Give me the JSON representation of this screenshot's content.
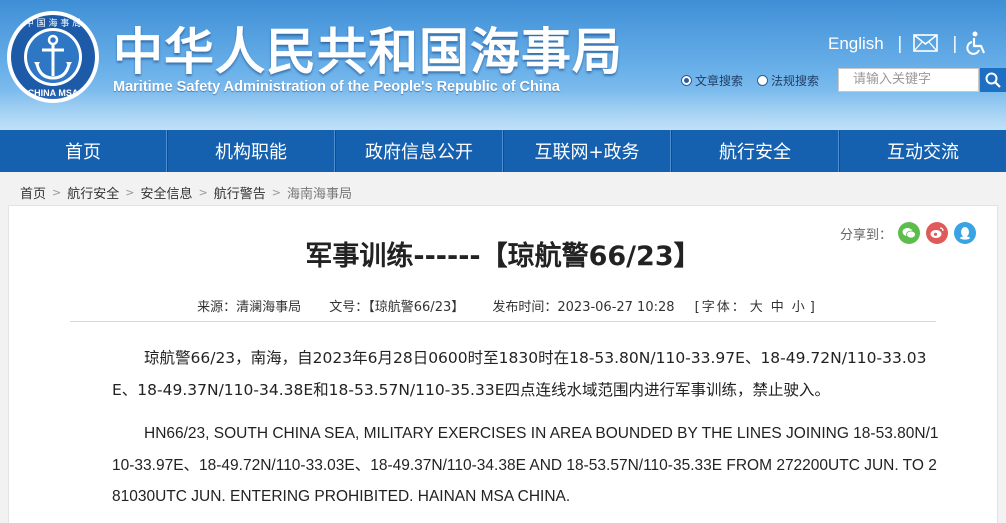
{
  "header": {
    "logo_text": "中国海事局 CHINA MSA",
    "title": "中华人民共和国海事局",
    "subtitle": "Maritime Safety Administration of the People's Republic of China",
    "english_link": "English",
    "separator": "|",
    "search_options": [
      "文章搜索",
      "法规搜索"
    ],
    "search_placeholder": "请输入关键字"
  },
  "nav": {
    "items": [
      "首页",
      "机构职能",
      "政府信息公开",
      "互联网+政务",
      "航行安全",
      "互动交流"
    ]
  },
  "breadcrumb": [
    "首页",
    "航行安全",
    "安全信息",
    "航行警告",
    "海南海事局"
  ],
  "share_label": "分享到：",
  "article": {
    "title": "军事训练------【琼航警66/23】",
    "source": "来源：清澜海事局",
    "doc_no": "文号：【琼航警66/23】",
    "published": "发布时间：2023-06-27 10:28",
    "font_label_open": "[字体：",
    "font_large": "大",
    "font_medium": "中",
    "font_small": "小",
    "font_label_close": "]",
    "para_cn": "琼航警66/23，南海，自2023年6月28日0600时至1830时在18-53.80N/110-33.97E、18-49.72N/110-33.03E、18-49.37N/110-34.38E和18-53.57N/110-35.33E四点连线水域范围内进行军事训练，禁止驶入。",
    "para_en": "HN66/23, SOUTH CHINA SEA, MILITARY EXERCISES IN AREA BOUNDED BY THE LINES JOINING 18-53.80N/110-33.97E、18-49.72N/110-33.03E、18-49.37N/110-34.38E AND 18-53.57N/110-35.33E FROM 272200UTC JUN. TO 281030UTC JUN. ENTERING PROHIBITED. HAINAN MSA CHINA."
  },
  "colors": {
    "nav_bg": "#1661af",
    "header_top": "#3f8fd6",
    "wechat": "#5cbd4c",
    "weibo": "#e05a5a",
    "qq": "#3aa3e3"
  }
}
